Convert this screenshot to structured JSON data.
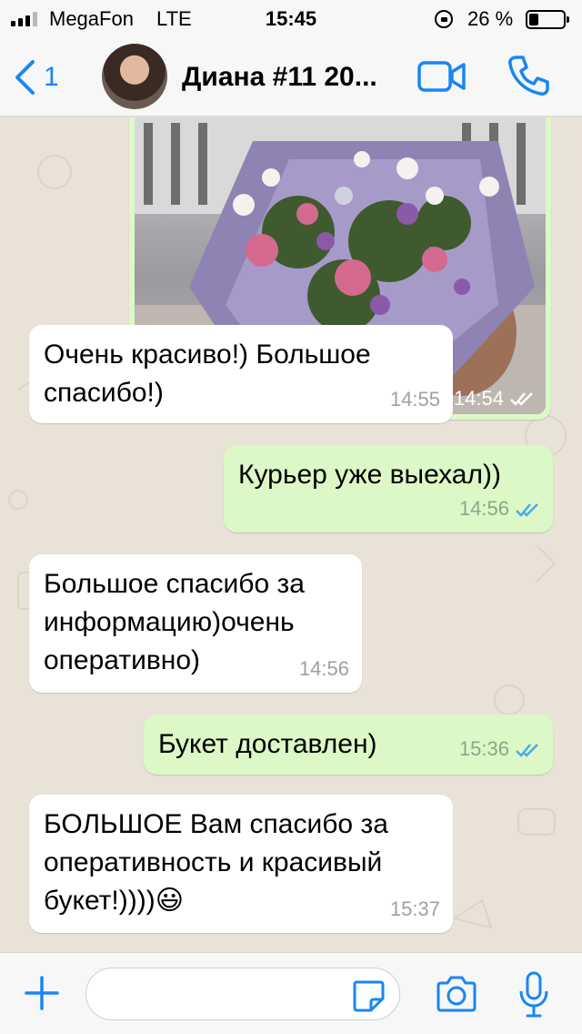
{
  "status_bar": {
    "carrier": "MegaFon",
    "network": "LTE",
    "time": "15:45",
    "battery_percent": "26 %"
  },
  "header": {
    "back_count": "1",
    "contact_name": "Диана #11 20...",
    "icons": [
      "back-chevron-icon",
      "video-call-icon",
      "phone-call-icon"
    ]
  },
  "messages": [
    {
      "direction": "out",
      "type": "photo",
      "time": "14:54",
      "status": "read"
    },
    {
      "direction": "in",
      "text": "Очень красиво!) Большое\nспасибо!)",
      "time": "14:55"
    },
    {
      "direction": "out",
      "text": "Курьер уже выехал))",
      "time": "14:56",
      "status": "read"
    },
    {
      "direction": "in",
      "text": "Большое спасибо за\nинформацию)очень\nоперативно)",
      "time": "14:56"
    },
    {
      "direction": "out",
      "text": "Букет доставлен)",
      "time": "15:36",
      "status": "read"
    },
    {
      "direction": "in",
      "text": "БОЛЬШОЕ Вам спасибо за\nоперативность и красивый\nбукет!))))",
      "emoji": "😃",
      "time": "15:37"
    }
  ],
  "input_bar": {
    "placeholder": "",
    "icons": [
      "plus-icon",
      "sticker-icon",
      "camera-icon",
      "microphone-icon"
    ]
  },
  "colors": {
    "accent": "#1a86f0",
    "outgoing_bubble": "#dcf8c6",
    "incoming_bubble": "#ffffff",
    "chat_background": "#e9e2d7",
    "read_ticks": "#4fa9e6"
  }
}
